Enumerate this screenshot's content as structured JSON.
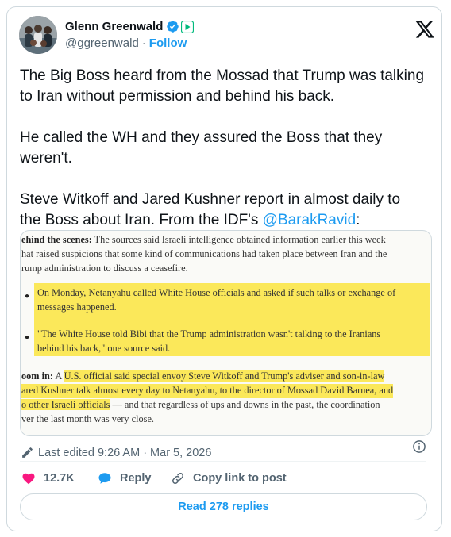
{
  "author": {
    "name": "Glenn Greenwald",
    "handle": "@ggreenwald",
    "separator": "·",
    "follow_label": "Follow",
    "verified_icon": "verified-badge-icon",
    "subscription_icon": "subscription-badge-icon"
  },
  "tweet": {
    "paragraph_1": "The Big Boss heard from the Mossad that Trump was talking to Iran without permission and behind his back.",
    "paragraph_2": "He called the WH and they assured the Boss that they weren't.",
    "paragraph_3_line_1": "Steve Witkoff and Jared Kushner report in almost daily  to",
    "paragraph_3_line_2_prefix": "the Boss about Iran. From the IDF's ",
    "paragraph_3_mention": "@BarakRavid",
    "paragraph_3_suffix": ":"
  },
  "media": {
    "lines": {
      "l1_bold": "ehind the scenes:",
      "l1_rest": " The sources said Israeli intelligence obtained information earlier this week",
      "l2": "hat raised suspicions that some kind of communications had taken place between Iran and the",
      "l3": "rump administration to discuss a ceasefire.",
      "b1_l1": "On Monday, Netanyahu called White House officials and asked if such talks or exchange of",
      "b1_l2": "messages happened.",
      "b2_l1": "\"The White House told Bibi that the Trump administration wasn't talking to the Iranians",
      "b2_l2": "behind his back,\" one source said.",
      "z1_bold": "oom in:",
      "z1_plain": " A ",
      "z1_hl": "U.S. official said special envoy Steve Witkoff and Trump's adviser and son-in-law",
      "z2": "ared Kushner talk almost every day to Netanyahu, to the director of Mossad David Barnea, and",
      "z3_hl": "o other Israeli officials",
      "z3_rest": " — and that regardless of ups and downs in the past, the coordination",
      "z4": "ver the last month was very close."
    }
  },
  "meta": {
    "edited_label": "Last edited 9:26 AM · Mar 5, 2026"
  },
  "actions": {
    "likes": "12.7K",
    "reply_label": "Reply",
    "copy_link_label": "Copy link to post"
  },
  "read_replies_label": "Read 278 replies",
  "colors": {
    "accent": "#1d9bf0",
    "like": "#f91880",
    "text": "#0f1419",
    "secondary": "#536471",
    "highlight": "#fbe85a",
    "border": "#cfd9de"
  }
}
